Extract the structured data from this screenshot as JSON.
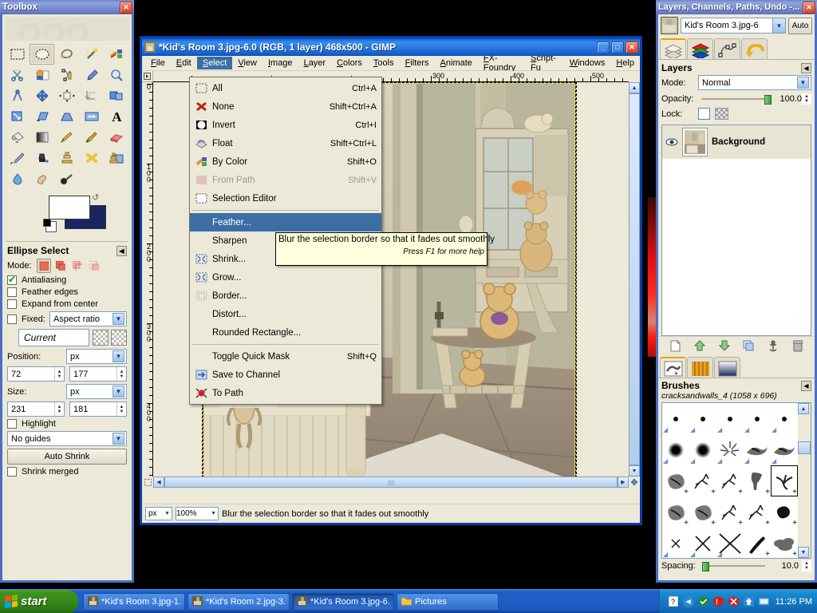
{
  "toolbox": {
    "title": "Toolbox",
    "close_label": "✕",
    "tools": [
      {
        "name": "rect-select-tool",
        "icon": "rect-select",
        "active": false
      },
      {
        "name": "ellipse-select-tool",
        "icon": "ellipse-select",
        "active": true
      },
      {
        "name": "free-select-tool",
        "icon": "lasso",
        "active": false
      },
      {
        "name": "fuzzy-select-tool",
        "icon": "magic-wand",
        "active": false
      },
      {
        "name": "by-color-select-tool",
        "icon": "by-color",
        "active": false
      },
      {
        "name": "scissors-select-tool",
        "icon": "scissors",
        "active": false
      },
      {
        "name": "foreground-select-tool",
        "icon": "foreground-select",
        "active": false
      },
      {
        "name": "paths-tool",
        "icon": "path",
        "active": false
      },
      {
        "name": "color-picker-tool",
        "icon": "eyedropper",
        "active": false
      },
      {
        "name": "zoom-tool",
        "icon": "magnifier",
        "active": false
      },
      {
        "name": "measure-tool",
        "icon": "compass",
        "active": false
      },
      {
        "name": "move-tool",
        "icon": "move-arrows",
        "active": false
      },
      {
        "name": "align-tool",
        "icon": "align",
        "active": false
      },
      {
        "name": "crop-tool",
        "icon": "crop",
        "active": false
      },
      {
        "name": "rotate-tool",
        "icon": "rotate",
        "active": false
      },
      {
        "name": "scale-tool",
        "icon": "scale",
        "active": false
      },
      {
        "name": "shear-tool",
        "icon": "shear",
        "active": false
      },
      {
        "name": "perspective-tool",
        "icon": "perspective",
        "active": false
      },
      {
        "name": "flip-tool",
        "icon": "flip",
        "active": false
      },
      {
        "name": "text-tool",
        "icon": "text-A",
        "active": false
      },
      {
        "name": "bucket-fill-tool",
        "icon": "bucket",
        "active": false
      },
      {
        "name": "blend-tool",
        "icon": "gradient",
        "active": false
      },
      {
        "name": "pencil-tool",
        "icon": "pencil",
        "active": false
      },
      {
        "name": "paintbrush-tool",
        "icon": "paintbrush",
        "active": false
      },
      {
        "name": "eraser-tool",
        "icon": "eraser",
        "active": false
      },
      {
        "name": "airbrush-tool",
        "icon": "airbrush",
        "active": false
      },
      {
        "name": "ink-tool",
        "icon": "ink",
        "active": false
      },
      {
        "name": "clone-tool",
        "icon": "clone-stamp",
        "active": false
      },
      {
        "name": "heal-tool",
        "icon": "heal",
        "active": false
      },
      {
        "name": "perspective-clone-tool",
        "icon": "perspective-clone",
        "active": false
      },
      {
        "name": "blur-sharpen-tool",
        "icon": "water-drop",
        "active": false
      },
      {
        "name": "smudge-tool",
        "icon": "smudge-finger",
        "active": false
      },
      {
        "name": "dodge-burn-tool",
        "icon": "dodge-burn",
        "active": false
      }
    ],
    "colors": {
      "foreground": "#ffffff",
      "background": "#1a2560"
    }
  },
  "tool_options": {
    "title": "Ellipse Select",
    "mode_label": "Mode:",
    "modes": [
      "replace",
      "add",
      "subtract",
      "intersect"
    ],
    "selected_mode": 0,
    "antialiasing": {
      "label": "Antialiasing",
      "checked": true
    },
    "feather_edges": {
      "label": "Feather edges",
      "checked": false
    },
    "expand_from_center": {
      "label": "Expand from center",
      "checked": false
    },
    "fixed": {
      "label": "Fixed:",
      "checked": false,
      "value": "Aspect ratio"
    },
    "current_value": "Current",
    "position": {
      "label": "Position:",
      "unit": "px",
      "x": "72",
      "y": "177"
    },
    "size": {
      "label": "Size:",
      "unit": "px",
      "w": "231",
      "h": "181"
    },
    "highlight": {
      "label": "Highlight",
      "checked": false
    },
    "guides": "No guides",
    "auto_shrink": "Auto Shrink",
    "shrink_merged": {
      "label": "Shrink merged",
      "checked": false
    }
  },
  "image_window": {
    "title": "*Kid's Room 3.jpg-6.0 (RGB, 1 layer) 468x500 - GIMP",
    "minimize": "_",
    "maximize": "□",
    "close": "✕",
    "menus": [
      "File",
      "Edit",
      "Select",
      "View",
      "Image",
      "Layer",
      "Colors",
      "Tools",
      "Filters",
      "Animate",
      "FX-Foundry",
      "Script-Fu",
      "Windows",
      "Help"
    ],
    "open_menu": "Select",
    "ruler_h_labels": [
      "300",
      "400",
      "500"
    ],
    "ruler_v_labels": [
      "0",
      "100",
      "200",
      "300",
      "400"
    ],
    "status": {
      "unit": "px",
      "zoom": "100%",
      "message": "Blur the selection border so that it fades out smoothly"
    }
  },
  "select_menu": {
    "items": [
      {
        "label": "All",
        "key": "Ctrl+A",
        "icon": "select-all-icon",
        "state": "normal"
      },
      {
        "label": "None",
        "key": "Shift+Ctrl+A",
        "icon": "select-none-icon",
        "state": "normal"
      },
      {
        "label": "Invert",
        "key": "Ctrl+I",
        "icon": "select-invert-icon",
        "state": "normal"
      },
      {
        "label": "Float",
        "key": "Shift+Ctrl+L",
        "icon": "select-float-icon",
        "state": "normal"
      },
      {
        "label": "By Color",
        "key": "Shift+O",
        "icon": "select-by-color-icon",
        "state": "normal"
      },
      {
        "label": "From Path",
        "key": "Shift+V",
        "icon": "select-from-path-icon",
        "state": "disabled"
      },
      {
        "label": "Selection Editor",
        "key": "",
        "icon": "selection-editor-icon",
        "state": "normal"
      },
      {
        "separator": true
      },
      {
        "label": "Feather...",
        "key": "",
        "icon": "",
        "state": "highlighted"
      },
      {
        "label": "Sharpen",
        "key": "",
        "icon": "",
        "state": "normal"
      },
      {
        "label": "Shrink...",
        "key": "",
        "icon": "shrink-icon",
        "state": "normal"
      },
      {
        "label": "Grow...",
        "key": "",
        "icon": "grow-icon",
        "state": "normal"
      },
      {
        "label": "Border...",
        "key": "",
        "icon": "border-icon",
        "state": "normal"
      },
      {
        "label": "Distort...",
        "key": "",
        "icon": "",
        "state": "normal"
      },
      {
        "label": "Rounded Rectangle...",
        "key": "",
        "icon": "",
        "state": "normal"
      },
      {
        "separator": true
      },
      {
        "label": "Toggle Quick Mask",
        "key": "Shift+Q",
        "icon": "",
        "state": "normal"
      },
      {
        "label": "Save to Channel",
        "key": "",
        "icon": "save-to-channel-icon",
        "state": "normal"
      },
      {
        "label": "To Path",
        "key": "",
        "icon": "to-path-icon",
        "state": "normal"
      }
    ]
  },
  "tooltip": {
    "text": "Blur the selection border so that it fades out smoothly",
    "hint": "Press F1 for more help"
  },
  "dock": {
    "title": "Layers, Channels, Paths, Undo -...",
    "close_label": "✕",
    "image_name": "Kid's Room 3.jpg-6",
    "auto_button": "Auto",
    "tabs": [
      "layers-tab",
      "channels-tab",
      "paths-tab",
      "undo-history-tab"
    ],
    "selected_tab": 0,
    "layers_panel": {
      "title": "Layers",
      "mode_label": "Mode:",
      "mode_value": "Normal",
      "opacity_label": "Opacity:",
      "opacity_value": "100.0",
      "lock_label": "Lock:",
      "layers": [
        {
          "name": "Background",
          "visible": true
        }
      ],
      "buttons": [
        "new-layer",
        "raise-layer",
        "lower-layer",
        "duplicate-layer",
        "anchor-layer",
        "delete-layer"
      ]
    },
    "bottom_tabs": [
      "brushes-tab",
      "patterns-tab",
      "gradients-tab"
    ],
    "bottom_selected_tab": 0,
    "brushes_panel": {
      "title": "Brushes",
      "selected_brush": "cracksandwalls_4 (1058 x 696)",
      "spacing_label": "Spacing:",
      "spacing_value": "10.0"
    }
  },
  "taskbar": {
    "start_label": "start",
    "tasks": [
      {
        "label": "*Kid's Room 3.jpg-1....",
        "active": false
      },
      {
        "label": "*Kid's Room 2.jpg-3....",
        "active": false
      },
      {
        "label": "*Kid's Room 3.jpg-6....",
        "active": true
      },
      {
        "label": "Pictures",
        "active": false
      }
    ],
    "tray_icons": [
      "help-icon",
      "chevron-left-icon",
      "shield-icon",
      "security-alert-icon",
      "virus-icon",
      "update-icon",
      "network-icon"
    ],
    "clock": "11:26 PM"
  },
  "colors": {
    "xp_blue": "#0a57c2",
    "menu_highlight": "#3a6ea5",
    "face": "#ece9d8",
    "tooltip_bg": "#ffffdd",
    "accent_orange": "#f0a000"
  }
}
